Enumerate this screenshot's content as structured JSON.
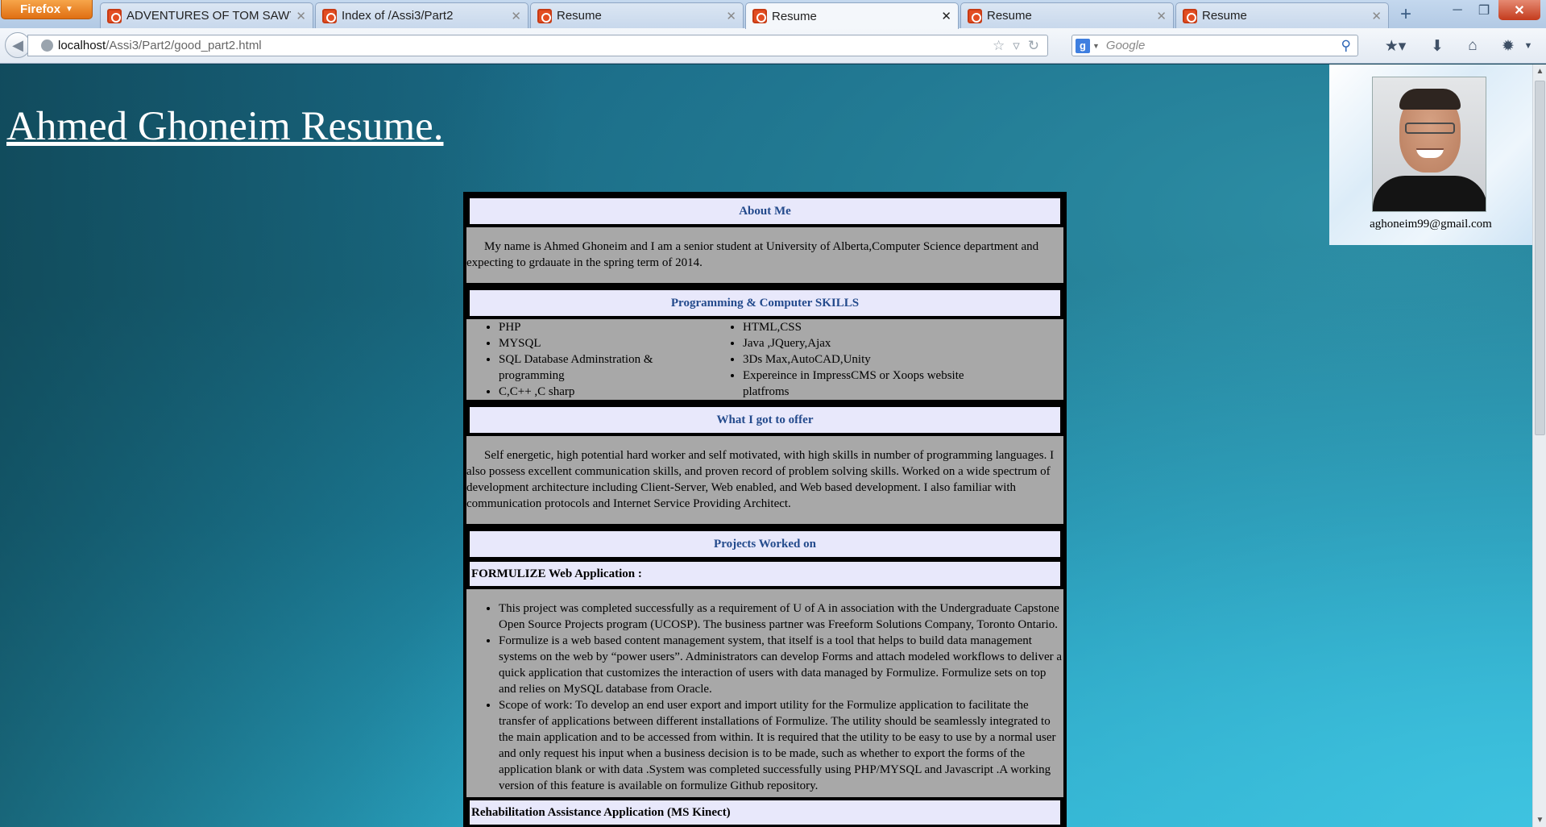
{
  "browser": {
    "menu_button": "Firefox",
    "tabs": [
      {
        "title": "ADVENTURES OF TOM SAWYE...",
        "active": false
      },
      {
        "title": "Index of /Assi3/Part2",
        "active": false
      },
      {
        "title": "Resume",
        "active": false
      },
      {
        "title": "Resume",
        "active": true
      },
      {
        "title": "Resume",
        "active": false
      },
      {
        "title": "Resume",
        "active": false
      }
    ],
    "url_host": "localhost",
    "url_path": "/Assi3/Part2/good_part2.html",
    "search_placeholder": "Google",
    "search_engine_badge": "g"
  },
  "page": {
    "title": "Ahmed Ghoneim Resume.",
    "email": "aghoneim99@gmail.com",
    "about": {
      "heading": "About Me",
      "text": "My name is Ahmed Ghoneim and I am a senior student at University of Alberta,Computer Science department and expecting to grdauate in the spring term of 2014."
    },
    "skills": {
      "heading": "Programming & Computer SKILLS",
      "left": [
        "PHP",
        "MYSQL",
        "SQL Database Adminstration & programming",
        "C,C++ ,C sharp"
      ],
      "right": [
        "HTML,CSS",
        "Java ,JQuery,Ajax",
        "3Ds Max,AutoCAD,Unity",
        "Expereince in ImpressCMS or Xoops website platfroms"
      ]
    },
    "offer": {
      "heading": "What I got to offer",
      "text": "Self energetic, high potential hard worker and self motivated, with high skills in number of programming languages. I also possess excellent communication skills, and proven record of problem solving skills. Worked on a wide spectrum of development architecture including Client-Server, Web enabled, and Web based development. I also familiar with communication protocols and Internet Service Providing Architect."
    },
    "projects": {
      "heading": "Projects Worked on",
      "items": [
        {
          "name": "FORMULIZE Web Application :",
          "bullets": [
            "This project was completed successfully as a requirement of U of A in association with the Undergraduate Capstone Open Source Projects program (UCOSP). The business partner was Freeform Solutions Company, Toronto Ontario.",
            "Formulize is a web based content management system, that itself is a tool that helps to build data management systems on the web by “power users”. Administrators can develop Forms and attach modeled workflows to deliver a quick application that customizes the interaction of users with data managed by Formulize. Formulize sets on top and relies on MySQL database from Oracle.",
            "Scope of work: To develop an end user export and import utility for the Formulize application to facilitate the transfer of applications between different installations of Formulize. The utility should be seamlessly integrated to the main application and to be accessed from within. It is required that the utility to be easy to use by a normal user and only request his input when a business decision is to be made, such as whether to export the forms of the application blank or with data .System was completed successfully using PHP/MYSQL and Javascript .A working version of this feature is available on formulize Github repository."
          ]
        }
      ],
      "next_item_partial": "Rehabilitation Assistance Application (MS Kinect)"
    }
  }
}
